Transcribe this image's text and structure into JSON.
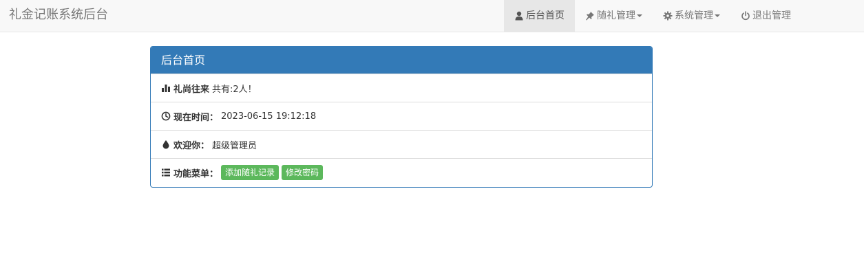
{
  "brand": "礼金记账系统后台",
  "nav": {
    "home": "后台首页",
    "gift_manage": "随礼管理",
    "system_manage": "系统管理",
    "logout": "退出管理"
  },
  "panel": {
    "title": "后台首页",
    "rows": {
      "stats": {
        "label": "礼尚往来",
        "value": "共有:2人！"
      },
      "time": {
        "label": "现在时间：",
        "value": "2023-06-15 19:12:18"
      },
      "welcome": {
        "label": "欢迎你：",
        "value": "超级管理员"
      },
      "menu": {
        "label": "功能菜单：",
        "buttons": [
          "添加随礼记录",
          "修改密码"
        ]
      }
    }
  },
  "icons": {
    "home": "user-icon",
    "gift_manage": "pushpin-icon",
    "system_manage": "gear-icon",
    "logout": "power-icon",
    "stats": "bar-chart-icon",
    "time": "clock-icon",
    "welcome": "droplet-icon",
    "menu": "list-icon"
  },
  "colors": {
    "primary": "#337ab7",
    "success": "#5cb85c",
    "navbar_bg": "#f8f8f8",
    "nav_active_bg": "#e7e7e7"
  }
}
